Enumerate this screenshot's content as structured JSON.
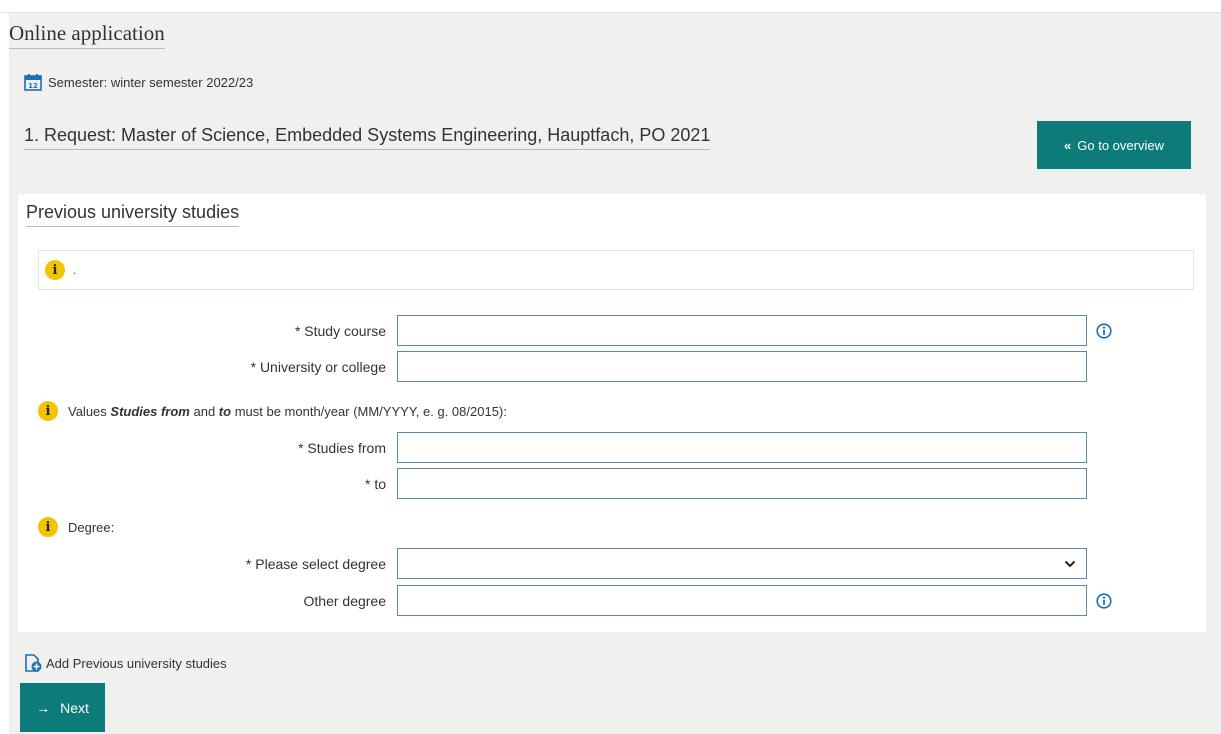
{
  "page": {
    "title": "Online application"
  },
  "semester": {
    "text": "Semester: winter semester 2022/23",
    "icon": "calendar-icon"
  },
  "request": {
    "title": "1. Request: Master of Science, Embedded Systems Engineering, Hauptfach, PO 2021"
  },
  "buttons": {
    "overview_label": "Go to overview",
    "next_label": "Next",
    "overview_icon": "«",
    "next_icon": "→"
  },
  "panel": {
    "title": "Previous university studies",
    "info_text": ".",
    "fields": {
      "study_course": {
        "label": "* Study course",
        "value": ""
      },
      "university": {
        "label": "* University or college",
        "value": ""
      },
      "studies_from": {
        "label": "* Studies from",
        "value": ""
      },
      "studies_to": {
        "label": "* to",
        "value": ""
      },
      "degree_select": {
        "label": "* Please select degree",
        "value": ""
      },
      "other_degree": {
        "label": "Other degree",
        "value": ""
      }
    },
    "notes": {
      "dates_pre": "Values ",
      "dates_b1": "Studies from",
      "dates_mid": " and ",
      "dates_b2": "to",
      "dates_post": " must be month/year (MM/YYYY, e. g. 08/2015):",
      "degree": "Degree:"
    }
  },
  "add_link": {
    "label": "Add Previous university studies"
  },
  "colors": {
    "accent": "#0e7b7b",
    "info": "#f3c400",
    "help": "#1a6fb5"
  }
}
